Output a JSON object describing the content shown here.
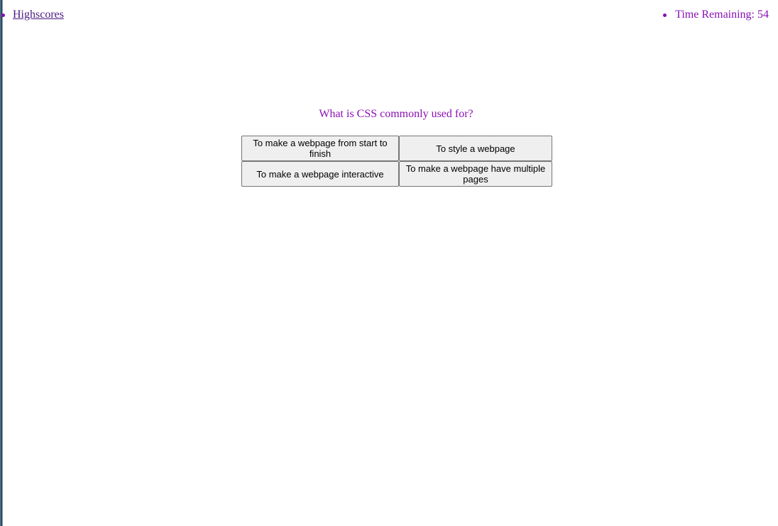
{
  "nav": {
    "highscores_label": "Highscores",
    "timer_label": "Time Remaining: 54"
  },
  "quiz": {
    "question": "What is CSS commonly used for?",
    "answers": [
      "To make a webpage from start to finish",
      "To style a webpage",
      "To make a webpage interactive",
      "To make a webpage have multiple pages"
    ]
  },
  "colors": {
    "accent": "#8a10b5",
    "link": "#4a1a82",
    "button_bg": "#efefef",
    "button_border": "#767676"
  }
}
